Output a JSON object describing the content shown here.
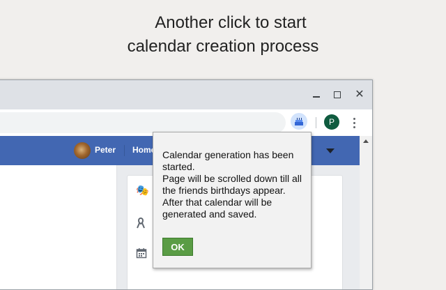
{
  "caption": {
    "line1": "Another click to start",
    "line2": "calendar creation process"
  },
  "browser": {
    "window_controls": [
      "minimize",
      "maximize",
      "close"
    ],
    "extension_icon": "birthday-cake-icon",
    "profile_initial": "P",
    "profile_color": "#0f5b3f"
  },
  "facebook": {
    "bar_color": "#4267b2",
    "user_name": "Peter",
    "nav_home": "Home"
  },
  "popup": {
    "messages": [
      "Calendar generation has been started.",
      "Page will be scrolled down till all the friends birthdays appear.",
      "After that calendar will be generated and saved."
    ],
    "ok_label": "OK",
    "ok_color": "#5a9c45"
  }
}
